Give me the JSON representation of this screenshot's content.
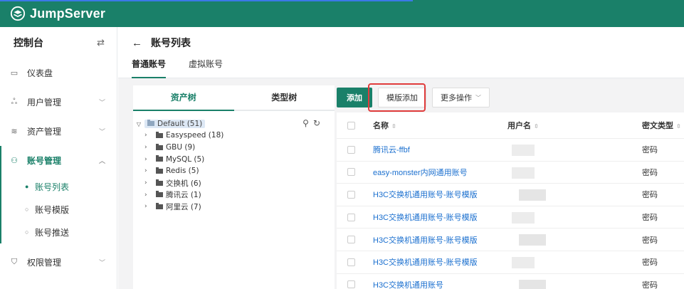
{
  "app": {
    "name": "JumpServer",
    "brand_color": "#1a8069"
  },
  "sidebar": {
    "title": "控制台",
    "switch_icon": "switch-icon",
    "items": [
      {
        "label": "仪表盘",
        "icon": "dashboard-icon"
      },
      {
        "label": "用户管理",
        "icon": "users-icon"
      },
      {
        "label": "资产管理",
        "icon": "assets-icon"
      },
      {
        "label": "账号管理",
        "icon": "accounts-icon"
      },
      {
        "label": "权限管理",
        "icon": "permission-icon"
      }
    ],
    "sub_items": [
      {
        "label": "账号列表",
        "active": true
      },
      {
        "label": "账号模版",
        "active": false
      },
      {
        "label": "账号推送",
        "active": false
      }
    ]
  },
  "page": {
    "title": "账号列表",
    "tabs": [
      {
        "label": "普通账号",
        "active": true
      },
      {
        "label": "虚拟账号",
        "active": false
      }
    ]
  },
  "tree": {
    "tabs": [
      {
        "label": "资产树",
        "active": true
      },
      {
        "label": "类型树",
        "active": false
      }
    ],
    "root": "Default (51)",
    "nodes": [
      "Easyspeed (18)",
      "GBU (9)",
      "MySQL (5)",
      "Redis (5)",
      "交换机 (6)",
      "腾讯云 (1)",
      "阿里云 (7)"
    ]
  },
  "toolbar": {
    "add_label": "添加",
    "template_add_label": "模版添加",
    "more_label": "更多操作"
  },
  "table": {
    "headers": {
      "name": "名称",
      "username": "用户名",
      "secret_type": "密文类型"
    },
    "rows": [
      {
        "name": "腾讯云-ffbf",
        "secret_type": "密码"
      },
      {
        "name": "easy-monster内网通用账号",
        "secret_type": "密码"
      },
      {
        "name": "H3C交换机通用账号-账号模版",
        "secret_type": "密码"
      },
      {
        "name": "H3C交换机通用账号-账号模版",
        "secret_type": "密码"
      },
      {
        "name": "H3C交换机通用账号-账号模版",
        "secret_type": "密码"
      },
      {
        "name": "H3C交换机通用账号-账号模版",
        "secret_type": "密码"
      },
      {
        "name": "H3C交换机通用账号",
        "secret_type": "密码"
      }
    ]
  }
}
